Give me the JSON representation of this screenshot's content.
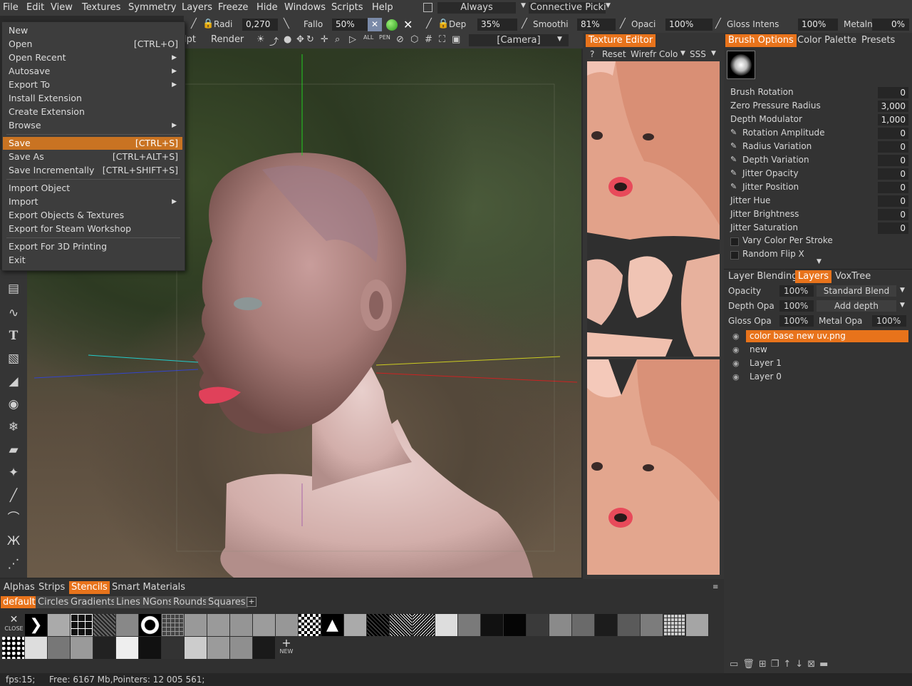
{
  "menubar": [
    "File",
    "Edit",
    "View",
    "Textures",
    "Symmetry",
    "Layers",
    "Freeze",
    "Hide",
    "Windows",
    "Scripts",
    "Help"
  ],
  "top_toolbar": {
    "always_label": "Always",
    "connective_label": "Connective Picki",
    "radius_label": "Radi",
    "radius_value": "0,270",
    "falloff_label": "Fallo",
    "falloff_value": "50%",
    "depth_label": "Dep",
    "depth_value": "35%",
    "smoothing_label": "Smoothi",
    "smoothing_value": "81%",
    "opacity_label": "Opaci",
    "opacity_value": "100%",
    "gloss_label": "Gloss Intens",
    "gloss_value": "100%",
    "metalness_label": "Metalnes",
    "metalness_value": "0%",
    "sculpt_tab": "lpt",
    "render_tab": "Render",
    "camera_label": "[Camera]"
  },
  "file_menu": [
    {
      "label": "New",
      "shortcut": "",
      "arrow": false
    },
    {
      "label": "Open",
      "shortcut": "[CTRL+O]",
      "arrow": false
    },
    {
      "label": "Open Recent",
      "shortcut": "",
      "arrow": true
    },
    {
      "label": "Autosave",
      "shortcut": "",
      "arrow": true
    },
    {
      "label": "Export To",
      "shortcut": "",
      "arrow": true
    },
    {
      "label": "Install Extension",
      "shortcut": "",
      "arrow": false
    },
    {
      "label": "Create Extension",
      "shortcut": "",
      "arrow": false
    },
    {
      "label": "Browse",
      "shortcut": "",
      "arrow": true
    },
    {
      "label": "Save",
      "shortcut": "[CTRL+S]",
      "arrow": false
    },
    {
      "label": "Save As",
      "shortcut": "[CTRL+ALT+S]",
      "arrow": false
    },
    {
      "label": "Save Incrementally",
      "shortcut": "[CTRL+SHIFT+S]",
      "arrow": false
    },
    {
      "label": "Import Object",
      "shortcut": "",
      "arrow": false
    },
    {
      "label": "Import",
      "shortcut": "",
      "arrow": true
    },
    {
      "label": "Export Objects & Textures",
      "shortcut": "",
      "arrow": false
    },
    {
      "label": "Export for Steam Workshop",
      "shortcut": "",
      "arrow": false
    },
    {
      "label": "Export For 3D Printing",
      "shortcut": "",
      "arrow": false
    },
    {
      "label": "Exit",
      "shortcut": "",
      "arrow": false
    }
  ],
  "texture_editor": {
    "tab": "Texture Editor",
    "help": "?",
    "reset": "Reset",
    "wireframe": "Wirefr",
    "color": "Colo",
    "sss": "SSS"
  },
  "brush_panel": {
    "tabs": [
      "Brush Options",
      "Color Palette",
      "Presets"
    ],
    "options": [
      {
        "label": "Brush Rotation",
        "value": "0",
        "pen": false
      },
      {
        "label": "Zero Pressure Radius",
        "value": "3,000",
        "pen": false
      },
      {
        "label": "Depth Modulator",
        "value": "1,000",
        "pen": false
      },
      {
        "label": "Rotation Amplitude",
        "value": "0",
        "pen": true
      },
      {
        "label": "Radius Variation",
        "value": "0",
        "pen": true
      },
      {
        "label": "Depth Variation",
        "value": "0",
        "pen": true
      },
      {
        "label": "Jitter Opacity",
        "value": "0",
        "pen": true
      },
      {
        "label": "Jitter Position",
        "value": "0",
        "pen": true
      },
      {
        "label": "Jitter Hue",
        "value": "0",
        "pen": false
      },
      {
        "label": "Jitter Brightness",
        "value": "0",
        "pen": false
      },
      {
        "label": "Jitter Saturation",
        "value": "0",
        "pen": false
      }
    ],
    "vary_color": "Vary Color Per Stroke",
    "random_flip": "Random Flip X"
  },
  "layers_panel": {
    "tabs": [
      "Layer Blending",
      "Layers",
      "VoxTree"
    ],
    "opacity_label": "Opacity",
    "opacity_value": "100%",
    "blend_mode": "Standard Blend",
    "depth_label": "Depth Opa",
    "depth_value": "100%",
    "depth_mode": "Add depth",
    "gloss_label": "Gloss Opa",
    "gloss_value": "100%",
    "metal_label": "Metal Opa",
    "metal_value": "100%",
    "layers": [
      "color base new uv.png",
      "new",
      "Layer 1",
      "Layer 0"
    ]
  },
  "bottom_panel": {
    "tabs": [
      "Alphas",
      "Strips",
      "Stencils",
      "Smart Materials"
    ],
    "subtabs": [
      "default",
      "Circles",
      "Gradients",
      "Lines",
      "NGons",
      "Rounds",
      "Squares"
    ],
    "close_label": "CLOSE",
    "new_label": "NEW"
  },
  "status": {
    "fps": "fps:15;",
    "memory": "Free: 6167 Mb,Pointers: 12 005 561;"
  },
  "colors": {
    "accent": "#e8731b",
    "menu_highlight": "#c97322"
  }
}
